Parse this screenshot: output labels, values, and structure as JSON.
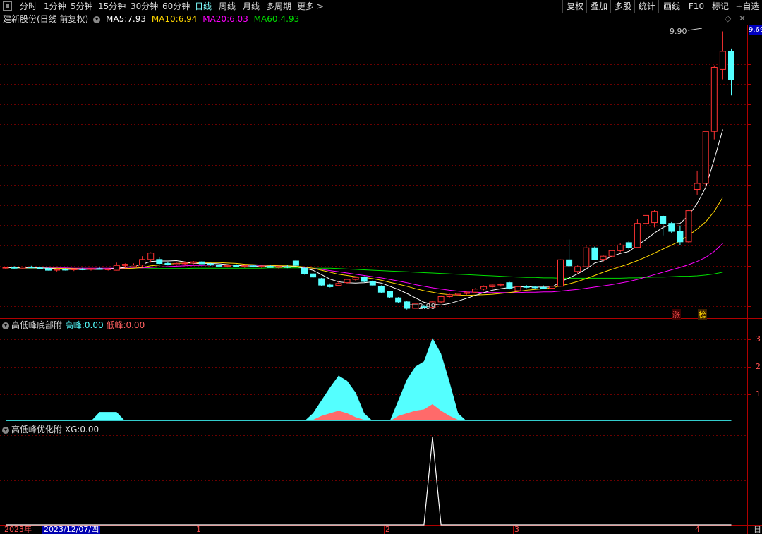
{
  "toolbar": {
    "periods": [
      "分时",
      "1分钟",
      "5分钟",
      "15分钟",
      "30分钟",
      "60分钟",
      "日线",
      "周线",
      "月线",
      "多周期",
      "更多"
    ],
    "active_period": "日线",
    "right_buttons": [
      "复权",
      "叠加",
      "多股",
      "统计",
      "画线",
      "F10",
      "标记",
      "+自选"
    ]
  },
  "stock": {
    "name": "建新股份(日线 前复权)",
    "ma5_label": "MA5:",
    "ma5": "7.93",
    "ma10_label": "MA10:",
    "ma10": "6.94",
    "ma20_label": "MA20:",
    "ma20": "6.03",
    "ma60_label": "MA60:",
    "ma60": "4.93",
    "high_label": "9.90",
    "low_label": "2.99",
    "last_price": "9.69",
    "tag_zhang": "涨",
    "tag_bang": "榜"
  },
  "indicator1": {
    "name": "高低峰底部附",
    "gaofeng_label": "高峰:",
    "gaofeng": "0.00",
    "difeng_label": "低峰:",
    "difeng": "0.00",
    "axis": [
      "3",
      "2",
      "1"
    ]
  },
  "indicator2": {
    "name": "高低峰优化附",
    "xg_label": "XG:",
    "xg": "0.00"
  },
  "dates": {
    "year": "2023年",
    "cursor_date": "2023/12/07/四",
    "m1": "1",
    "m2": "2",
    "m3": "3",
    "m4": "4",
    "right": "日"
  },
  "colors": {
    "up": "#ff3232",
    "down": "#54ffff",
    "ma5": "#ffffff",
    "ma10": "#ffd700",
    "ma20": "#ff00ff",
    "ma60": "#00e000",
    "grid": "#6a0000",
    "axis": "#b00000"
  },
  "chart_data": {
    "type": "candlestick",
    "ohlc": [
      [
        3.99,
        4.02,
        3.96,
        4.0
      ],
      [
        4.0,
        4.03,
        3.97,
        3.98
      ],
      [
        3.98,
        4.02,
        3.96,
        4.01
      ],
      [
        4.01,
        4.04,
        3.98,
        3.99
      ],
      [
        3.99,
        4.01,
        3.95,
        3.97
      ],
      [
        3.97,
        3.99,
        3.92,
        3.93
      ],
      [
        3.93,
        3.96,
        3.9,
        3.95
      ],
      [
        3.95,
        3.98,
        3.92,
        3.94
      ],
      [
        3.94,
        3.97,
        3.91,
        3.96
      ],
      [
        3.96,
        3.99,
        3.93,
        3.95
      ],
      [
        3.95,
        3.98,
        3.92,
        3.97
      ],
      [
        3.97,
        4.0,
        3.94,
        3.95
      ],
      [
        3.95,
        3.98,
        3.92,
        3.96
      ],
      [
        3.93,
        4.12,
        3.92,
        4.05
      ],
      [
        4.05,
        4.1,
        3.98,
        4.08
      ],
      [
        4.02,
        4.1,
        4.0,
        4.06
      ],
      [
        4.06,
        4.28,
        4.02,
        4.2
      ],
      [
        4.2,
        4.38,
        4.12,
        4.36
      ],
      [
        4.2,
        4.25,
        4.08,
        4.1
      ],
      [
        4.1,
        4.14,
        4.05,
        4.07
      ],
      [
        4.07,
        4.12,
        4.04,
        4.1
      ],
      [
        4.1,
        4.15,
        4.07,
        4.11
      ],
      [
        4.11,
        4.16,
        4.08,
        4.14
      ],
      [
        4.14,
        4.16,
        4.08,
        4.09
      ],
      [
        4.09,
        4.11,
        4.04,
        4.06
      ],
      [
        4.06,
        4.1,
        4.02,
        4.03
      ],
      [
        4.03,
        4.07,
        4.0,
        4.05
      ],
      [
        4.05,
        4.09,
        4.01,
        4.02
      ],
      [
        4.02,
        4.06,
        3.99,
        4.04
      ],
      [
        4.04,
        4.07,
        4.0,
        4.01
      ],
      [
        4.01,
        4.05,
        3.98,
        4.03
      ],
      [
        4.03,
        4.06,
        3.99,
        4.0
      ],
      [
        4.0,
        4.04,
        3.96,
        4.02
      ],
      [
        4.02,
        4.06,
        3.98,
        4.01
      ],
      [
        4.16,
        4.2,
        4.03,
        4.05
      ],
      [
        3.98,
        4.0,
        3.82,
        3.84
      ],
      [
        3.84,
        3.86,
        3.74,
        3.76
      ],
      [
        3.72,
        3.74,
        3.53,
        3.56
      ],
      [
        3.56,
        3.6,
        3.5,
        3.52
      ],
      [
        3.55,
        3.66,
        3.53,
        3.6
      ],
      [
        3.62,
        3.72,
        3.6,
        3.7
      ],
      [
        3.7,
        3.77,
        3.66,
        3.75
      ],
      [
        3.75,
        3.78,
        3.63,
        3.65
      ],
      [
        3.65,
        3.68,
        3.54,
        3.56
      ],
      [
        3.52,
        3.55,
        3.36,
        3.38
      ],
      [
        3.4,
        3.42,
        3.24,
        3.26
      ],
      [
        3.24,
        3.26,
        3.12,
        3.14
      ],
      [
        3.14,
        3.16,
        2.95,
        2.98
      ],
      [
        2.98,
        3.12,
        2.99,
        3.1
      ],
      [
        3.02,
        3.07,
        2.99,
        3.01
      ],
      [
        3.0,
        3.16,
        2.99,
        3.14
      ],
      [
        3.14,
        3.3,
        3.12,
        3.27
      ],
      [
        3.27,
        3.34,
        3.25,
        3.32
      ],
      [
        3.32,
        3.36,
        3.28,
        3.35
      ],
      [
        3.35,
        3.4,
        3.32,
        3.38
      ],
      [
        3.38,
        3.48,
        3.36,
        3.46
      ],
      [
        3.46,
        3.55,
        3.43,
        3.52
      ],
      [
        3.52,
        3.58,
        3.48,
        3.56
      ],
      [
        3.56,
        3.6,
        3.52,
        3.58
      ],
      [
        3.62,
        3.64,
        3.45,
        3.48
      ],
      [
        3.42,
        3.54,
        3.4,
        3.52
      ],
      [
        3.52,
        3.56,
        3.48,
        3.51
      ],
      [
        3.51,
        3.54,
        3.47,
        3.5
      ],
      [
        3.5,
        3.55,
        3.46,
        3.48
      ],
      [
        3.48,
        3.55,
        3.46,
        3.53
      ],
      [
        3.53,
        4.2,
        3.52,
        4.19
      ],
      [
        4.19,
        4.7,
        4.0,
        4.04
      ],
      [
        3.9,
        4.05,
        3.85,
        4.02
      ],
      [
        4.02,
        4.55,
        4.01,
        4.49
      ],
      [
        4.49,
        4.52,
        4.18,
        4.2
      ],
      [
        4.2,
        4.3,
        4.14,
        4.28
      ],
      [
        4.28,
        4.44,
        4.25,
        4.42
      ],
      [
        4.42,
        4.6,
        4.38,
        4.56
      ],
      [
        4.62,
        4.66,
        4.45,
        4.5
      ],
      [
        4.5,
        5.2,
        4.48,
        5.1
      ],
      [
        5.1,
        5.35,
        4.98,
        5.3
      ],
      [
        5.12,
        5.44,
        5.0,
        5.4
      ],
      [
        5.28,
        5.3,
        4.8,
        5.1
      ],
      [
        5.1,
        5.15,
        4.86,
        4.9
      ],
      [
        4.9,
        5.05,
        4.55,
        4.64
      ],
      [
        4.64,
        5.45,
        4.62,
        5.42
      ],
      [
        5.95,
        6.42,
        5.82,
        6.1
      ],
      [
        6.1,
        7.42,
        6.0,
        7.4
      ],
      [
        7.4,
        9.05,
        7.2,
        9.0
      ],
      [
        8.95,
        9.9,
        8.7,
        9.4
      ],
      [
        9.4,
        9.47,
        8.3,
        8.7
      ]
    ],
    "ma5": [
      4.0,
      3.99,
      3.99,
      3.99,
      3.99,
      3.98,
      3.96,
      3.95,
      3.95,
      3.95,
      3.95,
      3.95,
      3.96,
      3.98,
      4.0,
      4.03,
      4.08,
      4.15,
      4.16,
      4.16,
      4.17,
      4.14,
      4.1,
      4.1,
      4.1,
      4.09,
      4.07,
      4.05,
      4.04,
      4.03,
      4.03,
      4.02,
      4.02,
      4.02,
      4.02,
      3.98,
      3.93,
      3.82,
      3.71,
      3.64,
      3.62,
      3.61,
      3.62,
      3.64,
      3.61,
      3.53,
      3.45,
      3.35,
      3.24,
      3.13,
      3.08,
      3.06,
      3.1,
      3.16,
      3.23,
      3.3,
      3.37,
      3.43,
      3.47,
      3.5,
      3.51,
      3.52,
      3.51,
      3.51,
      3.51,
      3.64,
      3.74,
      3.84,
      3.96,
      4.11,
      4.17,
      4.28,
      4.35,
      4.4,
      4.55,
      4.7,
      4.86,
      5.0,
      5.08,
      5.1,
      5.3,
      5.6,
      6.0,
      6.7,
      7.45,
      7.93
    ],
    "ma10": [
      4.0,
      4.0,
      3.99,
      3.99,
      3.99,
      3.98,
      3.98,
      3.97,
      3.97,
      3.96,
      3.96,
      3.96,
      3.96,
      3.96,
      3.97,
      3.98,
      4.0,
      4.04,
      4.06,
      4.08,
      4.1,
      4.11,
      4.11,
      4.12,
      4.12,
      4.12,
      4.11,
      4.1,
      4.08,
      4.07,
      4.06,
      4.05,
      4.04,
      4.04,
      4.03,
      4.01,
      3.98,
      3.93,
      3.88,
      3.83,
      3.8,
      3.77,
      3.75,
      3.72,
      3.68,
      3.63,
      3.58,
      3.53,
      3.47,
      3.42,
      3.38,
      3.34,
      3.32,
      3.31,
      3.3,
      3.31,
      3.32,
      3.33,
      3.35,
      3.37,
      3.4,
      3.43,
      3.45,
      3.47,
      3.49,
      3.54,
      3.59,
      3.65,
      3.72,
      3.8,
      3.88,
      3.95,
      4.02,
      4.09,
      4.17,
      4.26,
      4.36,
      4.46,
      4.56,
      4.66,
      4.8,
      4.96,
      5.14,
      5.4,
      5.75,
      6.94
    ],
    "ma20": [
      4.0,
      4.0,
      4.0,
      4.0,
      3.99,
      3.99,
      3.99,
      3.99,
      3.98,
      3.98,
      3.98,
      3.98,
      3.98,
      3.98,
      3.98,
      3.99,
      3.99,
      4.0,
      4.01,
      4.02,
      4.03,
      4.04,
      4.05,
      4.05,
      4.06,
      4.06,
      4.06,
      4.06,
      4.06,
      4.06,
      4.05,
      4.05,
      4.04,
      4.03,
      4.02,
      4.0,
      3.98,
      3.95,
      3.92,
      3.89,
      3.86,
      3.83,
      3.8,
      3.77,
      3.74,
      3.7,
      3.66,
      3.62,
      3.57,
      3.53,
      3.49,
      3.46,
      3.43,
      3.41,
      3.39,
      3.38,
      3.37,
      3.37,
      3.37,
      3.37,
      3.37,
      3.38,
      3.38,
      3.39,
      3.39,
      3.41,
      3.43,
      3.45,
      3.48,
      3.51,
      3.54,
      3.57,
      3.61,
      3.65,
      3.7,
      3.76,
      3.82,
      3.88,
      3.94,
      4.0,
      4.07,
      4.15,
      4.25,
      4.4,
      4.6,
      6.03
    ],
    "ma60": [
      3.96,
      3.96,
      3.96,
      3.96,
      3.96,
      3.96,
      3.96,
      3.96,
      3.96,
      3.96,
      3.96,
      3.96,
      3.96,
      3.96,
      3.96,
      3.96,
      3.96,
      3.97,
      3.97,
      3.97,
      3.97,
      3.97,
      3.98,
      3.98,
      3.98,
      3.98,
      3.98,
      3.98,
      3.98,
      3.98,
      3.98,
      3.99,
      3.99,
      3.99,
      3.99,
      3.99,
      3.98,
      3.98,
      3.98,
      3.97,
      3.96,
      3.95,
      3.94,
      3.93,
      3.92,
      3.91,
      3.9,
      3.89,
      3.88,
      3.87,
      3.86,
      3.85,
      3.84,
      3.83,
      3.82,
      3.81,
      3.8,
      3.79,
      3.78,
      3.77,
      3.76,
      3.75,
      3.75,
      3.74,
      3.74,
      3.73,
      3.73,
      3.73,
      3.73,
      3.73,
      3.73,
      3.73,
      3.73,
      3.74,
      3.74,
      3.75,
      3.76,
      3.76,
      3.77,
      3.78,
      3.78,
      3.79,
      3.81,
      3.84,
      3.88,
      4.93
    ],
    "price_range": [
      2.75,
      10.05
    ],
    "gaofeng": [
      0,
      0,
      0,
      0,
      0,
      0,
      0,
      0,
      0,
      0,
      0,
      0,
      0,
      0,
      0,
      0,
      0,
      0,
      0,
      0,
      0,
      0,
      0,
      0,
      0,
      0,
      0,
      0,
      0,
      0,
      0,
      0,
      0,
      0,
      0,
      0,
      0.3,
      0.8,
      1.3,
      1.75,
      1.55,
      1.1,
      0.3,
      0,
      0,
      0,
      0.8,
      1.6,
      2.1,
      2.3,
      3.2,
      2.6,
      1.5,
      0.3,
      0,
      0,
      0,
      0,
      0,
      0,
      0,
      0,
      0,
      0,
      0,
      0,
      0,
      0,
      0,
      0,
      0,
      0,
      0,
      0,
      0,
      0,
      0,
      0,
      0,
      0,
      0,
      0,
      0,
      0,
      0,
      0
    ],
    "gaofeng_early": [
      0,
      0,
      0,
      0,
      0,
      0,
      0,
      0,
      0,
      0,
      0,
      0.35,
      0.35,
      0.35,
      0,
      0
    ],
    "difeng": [
      0,
      0,
      0,
      0,
      0,
      0,
      0,
      0,
      0,
      0,
      0,
      0,
      0,
      0,
      0,
      0,
      0,
      0,
      0,
      0,
      0,
      0,
      0,
      0,
      0,
      0,
      0,
      0,
      0,
      0,
      0,
      0,
      0,
      0,
      0,
      0,
      0.05,
      0.2,
      0.3,
      0.4,
      0.3,
      0.15,
      0.05,
      0,
      0,
      0,
      0.2,
      0.3,
      0.4,
      0.45,
      0.65,
      0.4,
      0.2,
      0.05,
      0,
      0,
      0,
      0,
      0,
      0,
      0,
      0,
      0,
      0,
      0,
      0,
      0,
      0,
      0,
      0,
      0,
      0,
      0,
      0,
      0,
      0,
      0,
      0,
      0,
      0,
      0,
      0,
      0,
      0,
      0,
      0
    ],
    "xg": [
      0,
      0,
      0,
      0,
      0,
      0,
      0,
      0,
      0,
      0,
      0,
      0,
      0,
      0,
      0,
      0,
      0,
      0,
      0,
      0,
      0,
      0,
      0,
      0,
      0,
      0,
      0,
      0,
      0,
      0,
      0,
      0,
      0,
      0,
      0,
      0,
      0,
      0,
      0,
      0,
      0,
      0,
      0,
      0,
      0,
      0,
      0,
      0,
      0,
      0,
      1,
      0,
      0,
      0,
      0,
      0,
      0,
      0,
      0,
      0,
      0,
      0,
      0,
      0,
      0,
      0,
      0,
      0,
      0,
      0,
      0,
      0,
      0,
      0,
      0,
      0,
      0,
      0,
      0,
      0,
      0,
      0,
      0,
      0,
      0,
      0
    ],
    "indicator1_range": [
      0,
      3.5
    ]
  }
}
